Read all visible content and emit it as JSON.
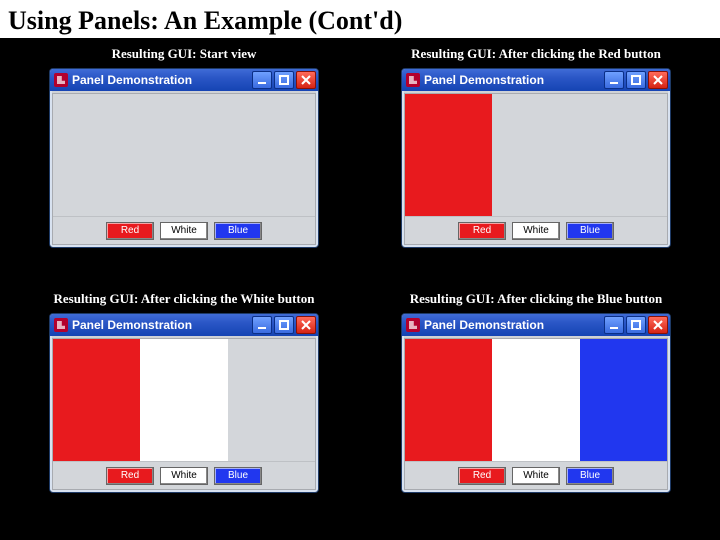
{
  "slide": {
    "title": "Using Panels: An Example (Cont'd)"
  },
  "windows": {
    "title": "Panel Demonstration",
    "buttons": {
      "red": "Red",
      "white": "White",
      "blue": "Blue"
    }
  },
  "captions": {
    "start": "Resulting GUI: Start view",
    "red": "Resulting GUI: After clicking the Red button",
    "white": "Resulting GUI: After clicking the White button",
    "blue": "Resulting GUI: After clicking the Blue button"
  },
  "states": {
    "start": {
      "left": "gray",
      "mid": "gray",
      "right": "gray"
    },
    "red": {
      "left": "red",
      "mid": "gray",
      "right": "gray"
    },
    "white": {
      "left": "red",
      "mid": "white",
      "right": "gray"
    },
    "blue": {
      "left": "red",
      "mid": "white",
      "right": "blue"
    }
  },
  "colors": {
    "red": "#e81a1e",
    "white": "#ffffff",
    "blue": "#2137ef",
    "gray": "#d3d6da"
  }
}
